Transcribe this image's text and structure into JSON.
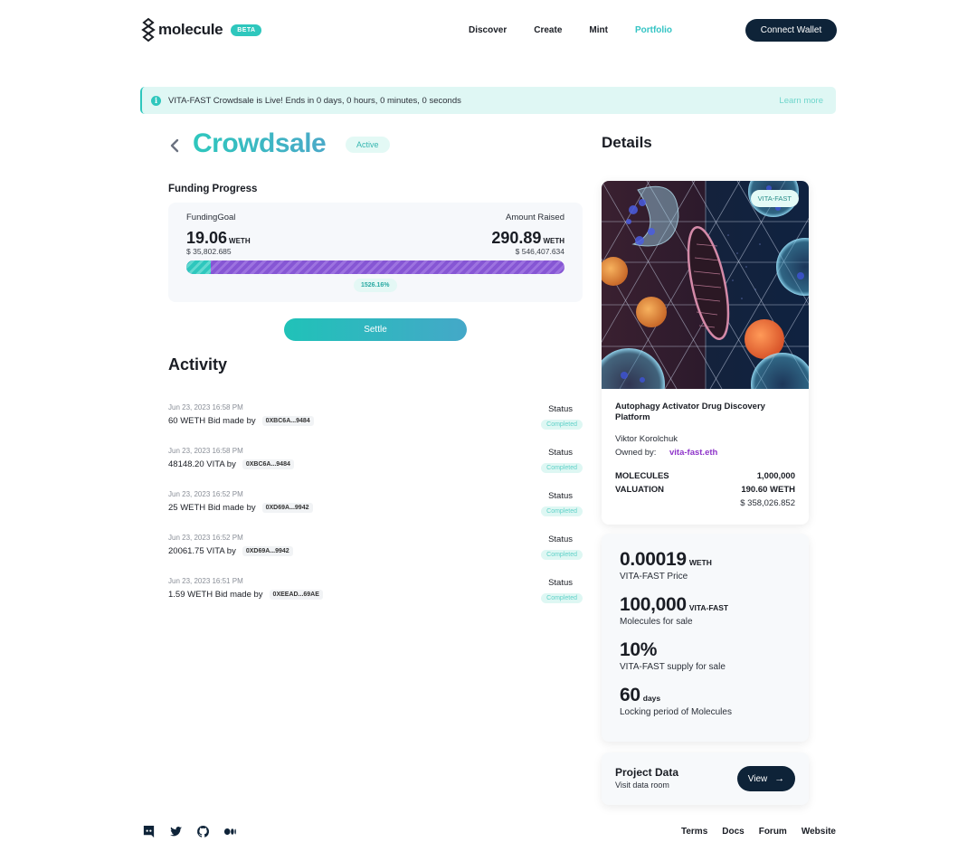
{
  "header": {
    "brand": "molecule",
    "badge": "BETA",
    "nav": [
      {
        "label": "Discover",
        "active": false
      },
      {
        "label": "Create",
        "active": false
      },
      {
        "label": "Mint",
        "active": false
      },
      {
        "label": "Portfolio",
        "active": true
      }
    ],
    "connect_label": "Connect Wallet"
  },
  "banner": {
    "icon": "info-icon",
    "message": "VITA-FAST Crowdsale is Live! Ends in 0 days, 0 hours, 0 minutes, 0 seconds",
    "link_label": "Learn more"
  },
  "crowdsale": {
    "back_icon": "chevron-left-icon",
    "title": "Crowdsale",
    "status": "Active",
    "funding_progress_label": "Funding Progress",
    "funding_goal_label": "FundingGoal",
    "funding_goal_value": "19.06",
    "funding_goal_unit": "WETH",
    "funding_goal_usd": "$ 35,802.685",
    "amount_raised_label": "Amount Raised",
    "amount_raised_value": "290.89",
    "amount_raised_unit": "WETH",
    "amount_raised_usd": "$ 546,407.634",
    "goal_fraction_of_bar": 0.0655,
    "percent_label": "1526.16%",
    "settle_label": "Settle"
  },
  "activity": {
    "title": "Activity",
    "items": [
      {
        "date": "Jun 23, 2023 16:58 PM",
        "text": "60 WETH Bid made by",
        "address": "0XBC6A...9484",
        "status_label": "Status",
        "status": "Completed"
      },
      {
        "date": "Jun 23, 2023 16:58 PM",
        "text": "48148.20 VITA by",
        "address": "0XBC6A...9484",
        "status_label": "Status",
        "status": "Completed"
      },
      {
        "date": "Jun 23, 2023 16:52 PM",
        "text": "25 WETH Bid made by",
        "address": "0XD69A...9942",
        "status_label": "Status",
        "status": "Completed"
      },
      {
        "date": "Jun 23, 2023 16:52 PM",
        "text": "20061.75 VITA by",
        "address": "0XD69A...9942",
        "status_label": "Status",
        "status": "Completed"
      },
      {
        "date": "Jun 23, 2023 16:51 PM",
        "text": "1.59 WETH Bid made by",
        "address": "0XEEAD...69AE",
        "status_label": "Status",
        "status": "Completed"
      }
    ]
  },
  "details": {
    "title": "Details",
    "ticker": "VITA-FAST",
    "project_name": "Autophagy Activator Drug Discovery Platform",
    "author": "Viktor Korolchuk",
    "owned_by_label": "Owned by:",
    "owner": "vita-fast.eth",
    "molecules_label": "MOLECULES",
    "molecules_value": "1,000,000",
    "valuation_label": "VALUATION",
    "valuation_value": "190.60 WETH",
    "valuation_usd": "$ 358,026.852"
  },
  "stats": [
    {
      "value": "0.00019",
      "unit": "WETH",
      "label": "VITA-FAST Price"
    },
    {
      "value": "100,000",
      "unit": "VITA-FAST",
      "label": "Molecules for sale"
    },
    {
      "value": "10%",
      "unit": "",
      "label": "VITA-FAST supply for sale"
    },
    {
      "value": "60",
      "unit": "days",
      "label": "Locking period of Molecules"
    }
  ],
  "project_data": {
    "title": "Project Data",
    "subtitle": "Visit data room",
    "button_label": "View",
    "button_icon": "arrow-right-icon"
  },
  "footer": {
    "socials": [
      "discord-icon",
      "twitter-icon",
      "github-icon",
      "medium-icon"
    ],
    "links": [
      "Terms",
      "Docs",
      "Forum",
      "Website"
    ]
  },
  "colors": {
    "accent": "#2ec7bd",
    "dark": "#0e2338",
    "progress_raised": "#8656d4",
    "owner_link": "#8e35c9"
  }
}
